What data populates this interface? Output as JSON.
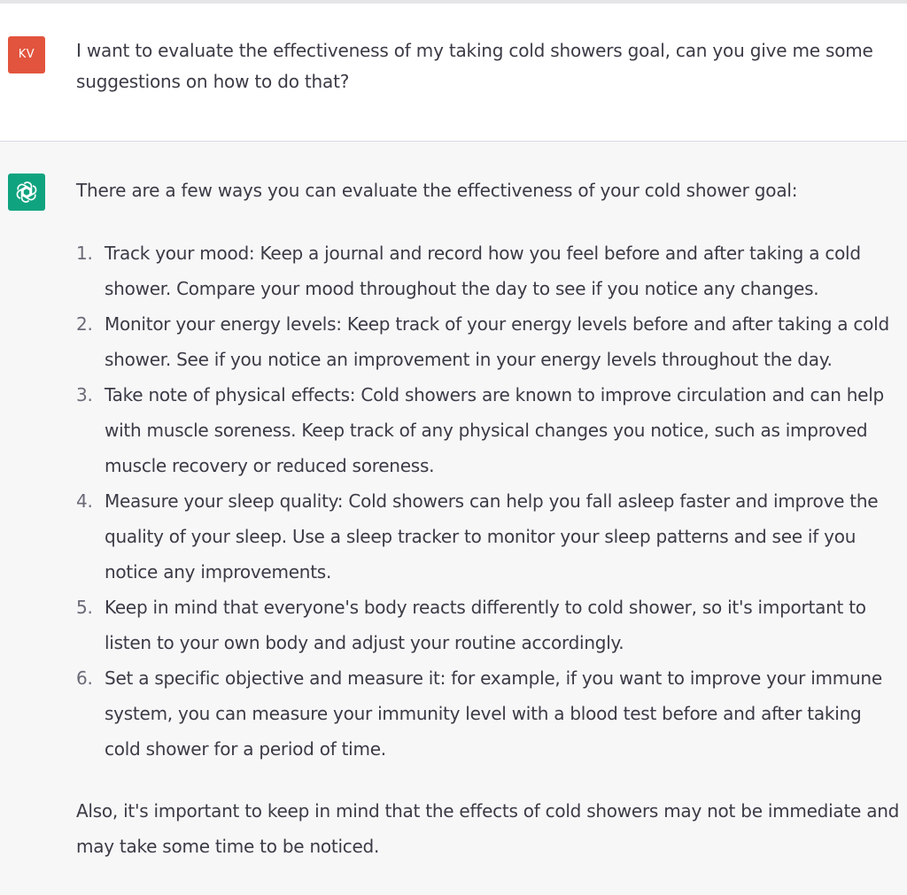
{
  "user_message": {
    "avatar_initials": "KV",
    "avatar_color": "#e2543d",
    "text": "I want to evaluate the effectiveness of my taking cold showers goal, can you give me some suggestions on how to do that?"
  },
  "assistant_message": {
    "avatar_icon": "openai-logo-icon",
    "avatar_color": "#10a37f",
    "intro": "There are a few ways you can evaluate the effectiveness of your cold shower goal:",
    "items": [
      {
        "number": "1.",
        "text": "Track your mood: Keep a journal and record how you feel before and after taking a cold shower. Compare your mood throughout the day to see if you notice any changes."
      },
      {
        "number": "2.",
        "text": "Monitor your energy levels: Keep track of your energy levels before and after taking a cold shower. See if you notice an improvement in your energy levels throughout the day."
      },
      {
        "number": "3.",
        "text": "Take note of physical effects: Cold showers are known to improve circulation and can help with muscle soreness. Keep track of any physical changes you notice, such as improved muscle recovery or reduced soreness."
      },
      {
        "number": "4.",
        "text": "Measure your sleep quality: Cold showers can help you fall asleep faster and improve the quality of your sleep. Use a sleep tracker to monitor your sleep patterns and see if you notice any improvements."
      },
      {
        "number": "5.",
        "text": "Keep in mind that everyone's body reacts differently to cold shower, so it's important to listen to your own body and adjust your routine accordingly."
      },
      {
        "number": "6.",
        "text": "Set a specific objective and measure it: for example, if you want to improve your immune system, you can measure your immunity level with a blood test before and after taking cold shower for a period of time."
      }
    ],
    "outro": "Also, it's important to keep in mind that the effects of cold showers may not be immediate and may take some time to be noticed."
  }
}
